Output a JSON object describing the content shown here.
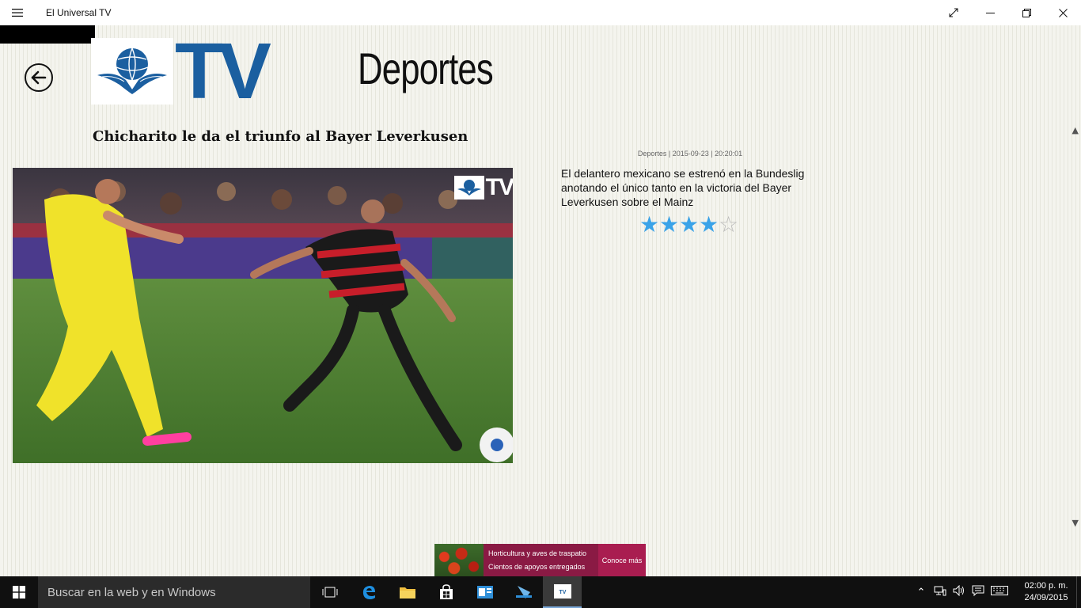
{
  "titlebar": {
    "app_title": "El Universal TV",
    "menu_icon": "hamburger-icon",
    "controls": [
      "fullscreen-icon",
      "minimize-icon",
      "restore-icon",
      "close-icon"
    ]
  },
  "header": {
    "logo_text": "TV",
    "section_title": "Deportes",
    "back_icon": "back-arrow-icon"
  },
  "article": {
    "headline": "Chicharito le da el triunfo al Bayer Leverkusen",
    "meta": "Deportes | 2015-09-23 | 20:20:01",
    "summary": "El delantero mexicano se estrenó en la Bundeslig anotando el único tanto en la victoria del Bayer Leverkusen sobre el Mainz",
    "rating": {
      "value": 4,
      "max": 5
    },
    "watermark_text": "TV"
  },
  "ad": {
    "line1": "Horticultura y aves de traspatio",
    "line2": "Cientos de apoyos entregados",
    "cta": "Conoce más"
  },
  "taskbar": {
    "search_placeholder": "Buscar en la web y en Windows",
    "clock_time": "02:00 p. m.",
    "clock_date": "24/09/2015",
    "apps": [
      "task-view-icon",
      "edge-icon",
      "file-explorer-icon",
      "store-icon",
      "outlook-icon",
      "network-app-icon",
      "eluniversal-tv-icon"
    ]
  },
  "colors": {
    "accent": "#1b5fa0",
    "star_on": "#3aa3e8",
    "star_off": "#bbbbbb",
    "ad_bg": "#8a1a44"
  }
}
